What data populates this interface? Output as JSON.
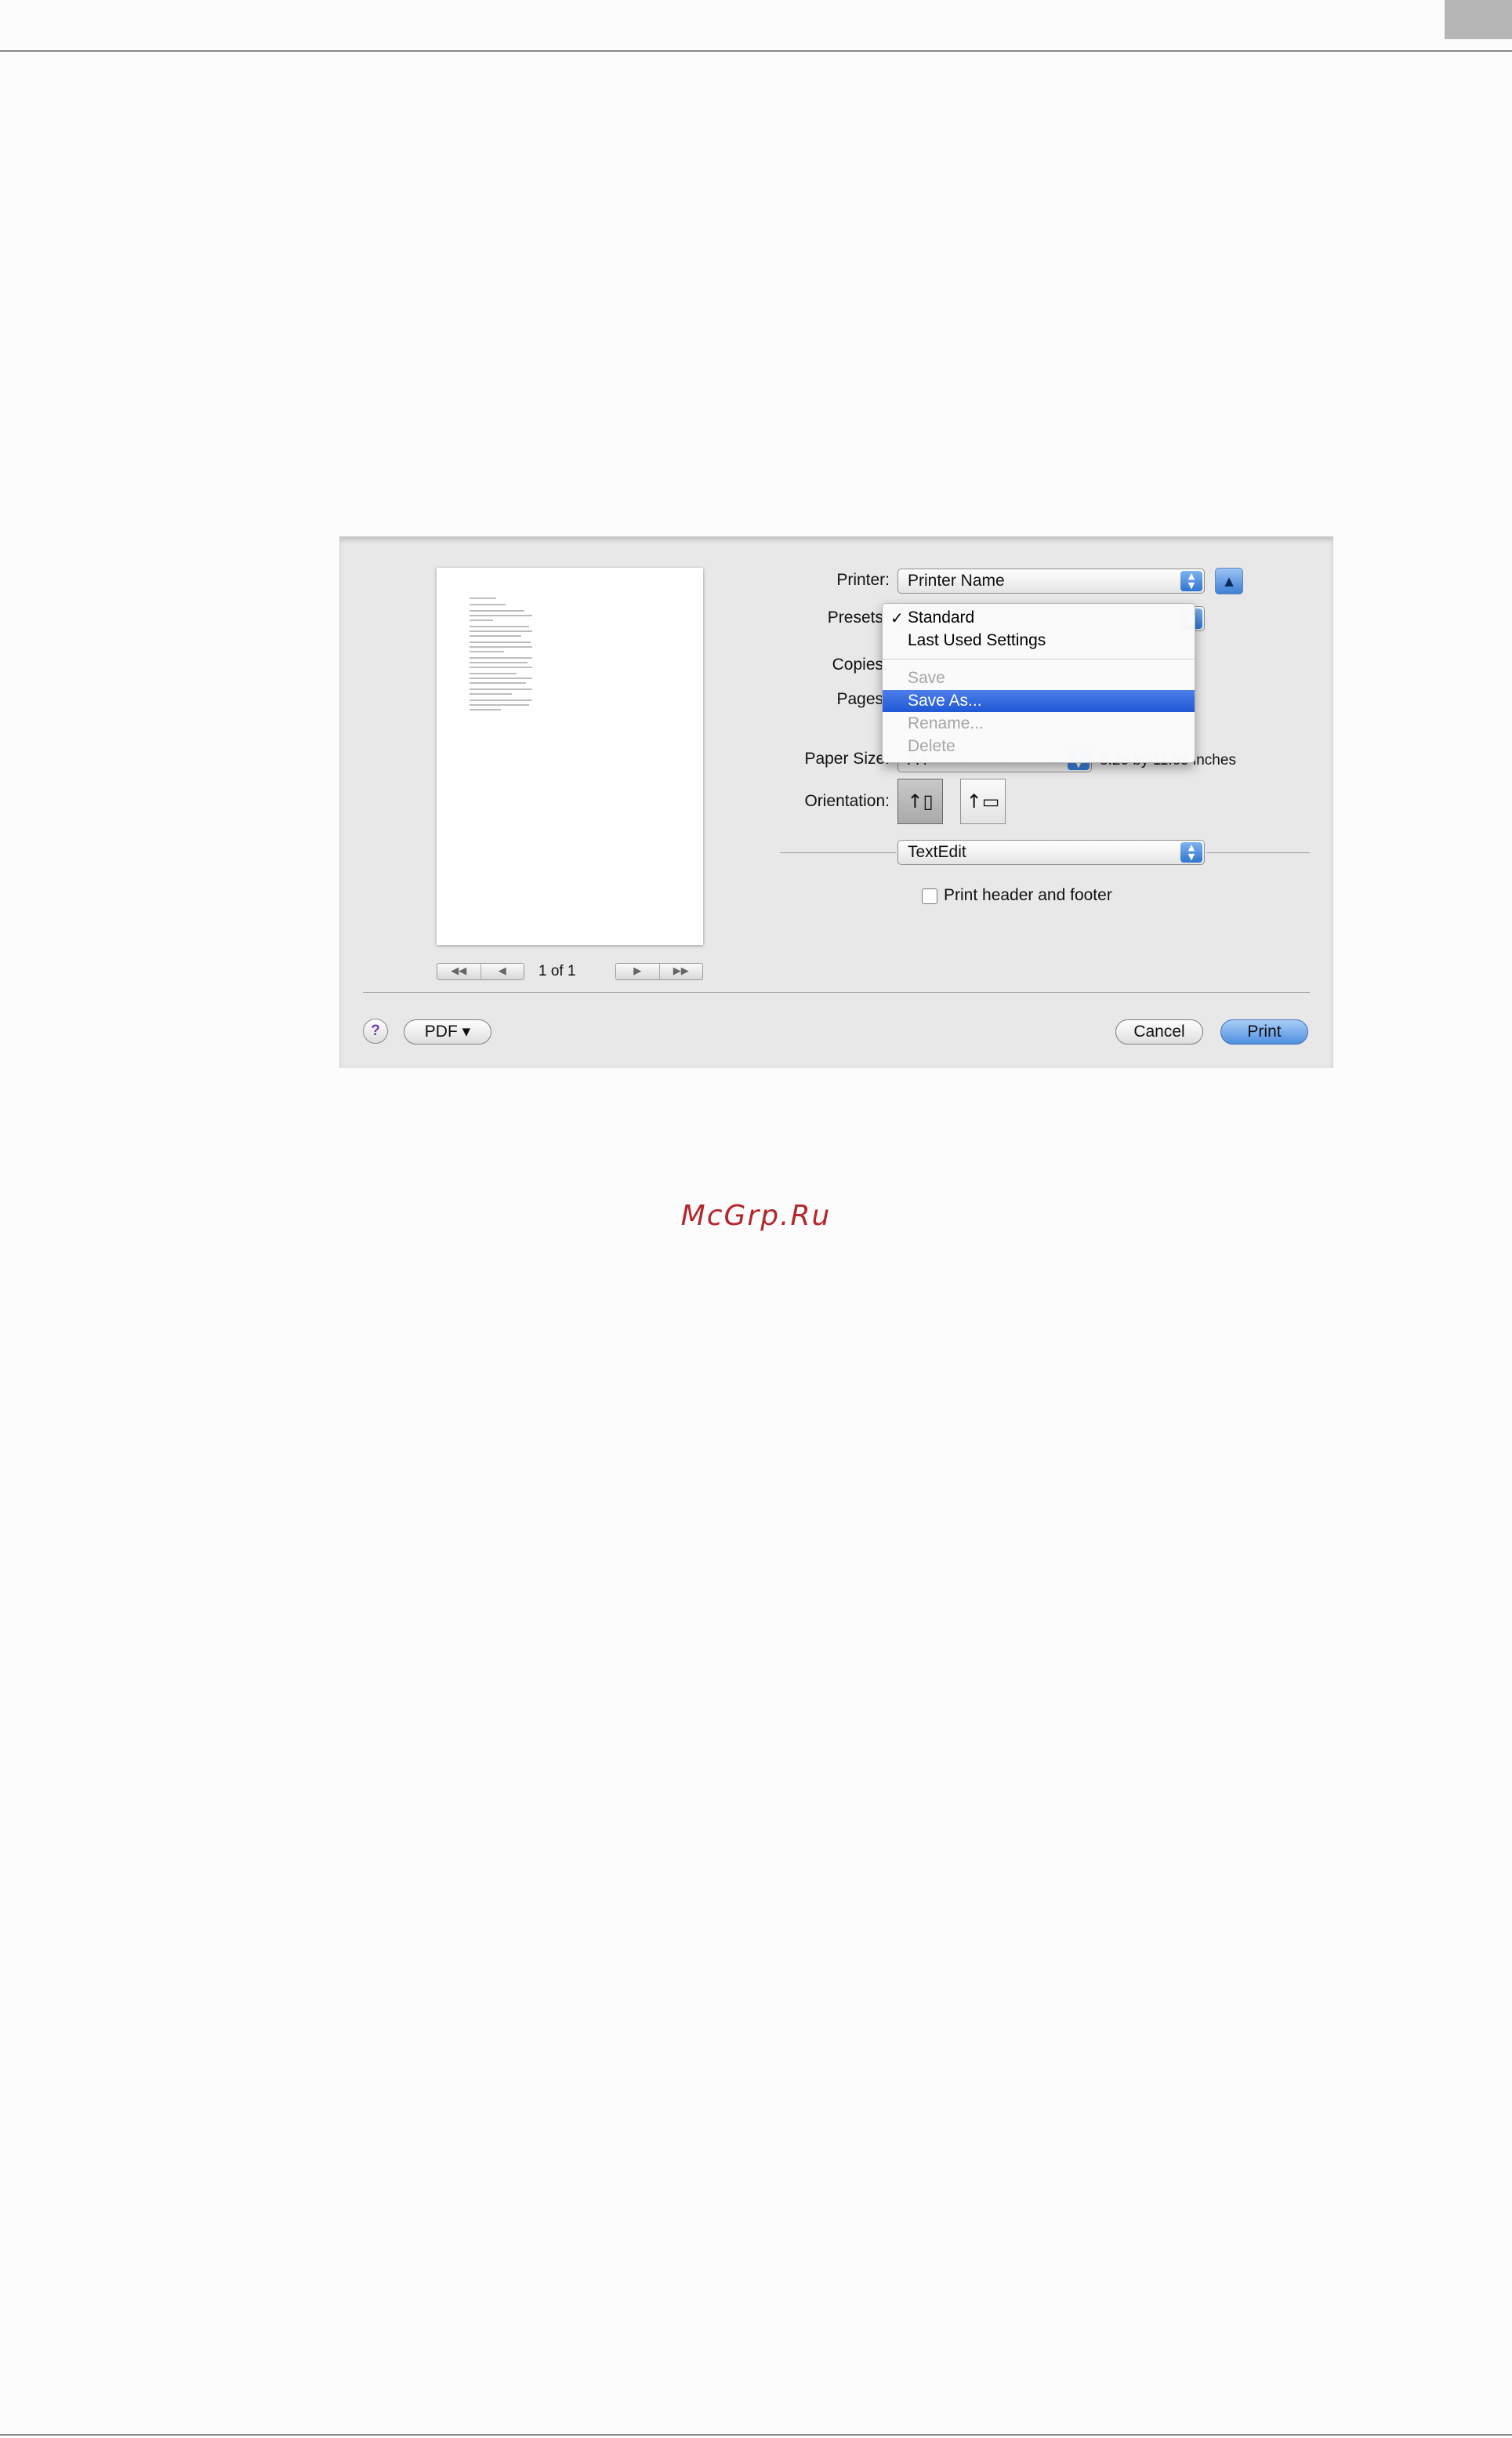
{
  "dialog": {
    "printer": {
      "label": "Printer:",
      "value": "Printer Name"
    },
    "presets": {
      "label": "Presets"
    },
    "copies": {
      "label": "Copies"
    },
    "pages": {
      "label": "Pages"
    },
    "paper_size": {
      "label": "Paper Size:",
      "value": "A4",
      "dimensions": "8.26 by 11.69 inches"
    },
    "orientation": {
      "label": "Orientation:"
    },
    "app_section": {
      "value": "TextEdit"
    },
    "print_header_footer": {
      "label": "Print header and footer",
      "checked": false
    },
    "preview": {
      "page_indicator": "1 of 1"
    },
    "footer": {
      "help": "?",
      "pdf": "PDF ▾",
      "cancel": "Cancel",
      "print": "Print"
    }
  },
  "presets_menu": {
    "items": [
      {
        "label": "Standard",
        "checked": true,
        "enabled": true
      },
      {
        "label": "Last Used Settings",
        "checked": false,
        "enabled": true
      },
      {
        "label": "Save",
        "checked": false,
        "enabled": false
      },
      {
        "label": "Save As...",
        "checked": false,
        "enabled": true,
        "highlighted": true
      },
      {
        "label": "Rename...",
        "checked": false,
        "enabled": false
      },
      {
        "label": "Delete",
        "checked": false,
        "enabled": false
      }
    ]
  },
  "watermark": "McGrp.Ru",
  "colors": {
    "accent": "#2f74d1",
    "menu_highlight": "#1f57d6",
    "watermark": "#b3262b"
  }
}
